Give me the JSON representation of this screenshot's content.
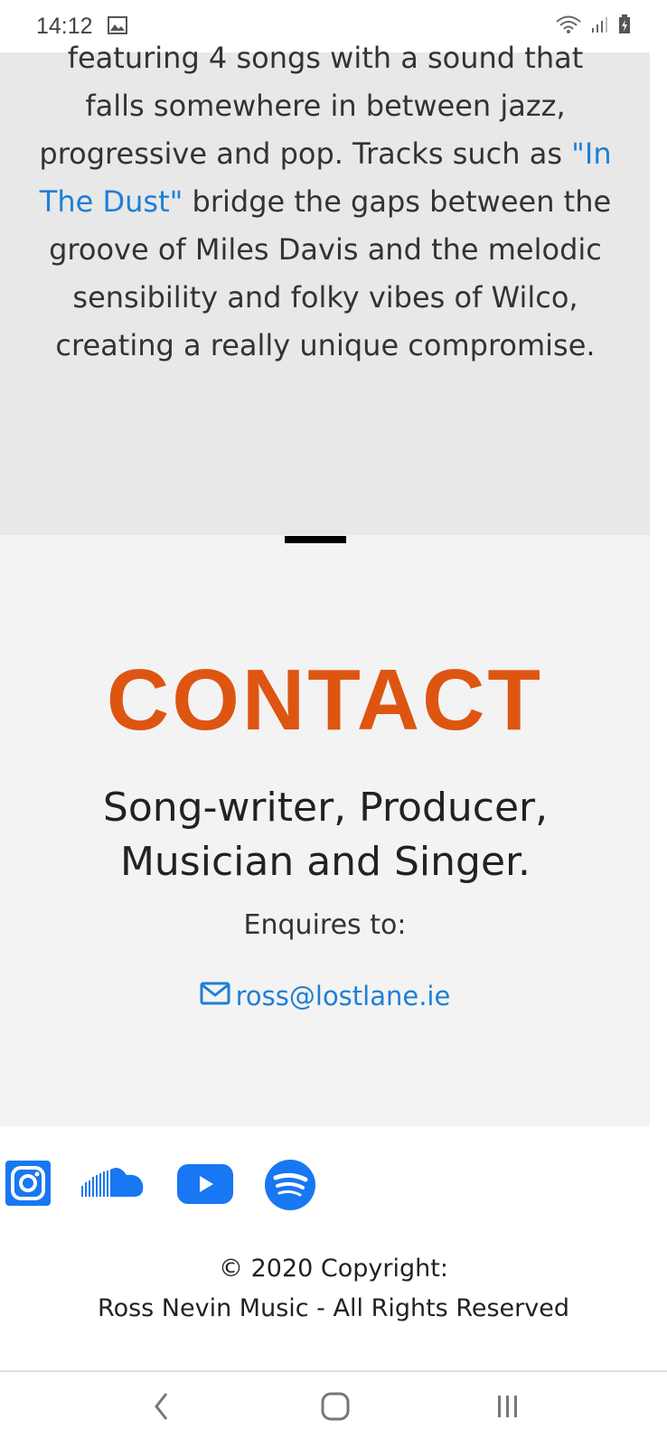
{
  "status_bar": {
    "time": "14:12"
  },
  "about": {
    "text_before_link": "featuring 4 songs with a sound that falls somewhere in between jazz, progressive and pop. Tracks such as ",
    "link_text": "\"In The Dust\"",
    "text_after_link": " bridge the gaps between the groove of Miles Davis and the melodic sensibility and folky vibes of Wilco, creating a really unique compromise."
  },
  "contact": {
    "title": "CONTACT",
    "subtitle": "Song-writer, Producer, Musician and Singer.",
    "enquiries_label": "Enquires to:",
    "email": "ross@lostlane.ie"
  },
  "social": [
    {
      "icon": "instagram-icon",
      "color": "#1877f2"
    },
    {
      "icon": "soundcloud-icon",
      "color": "#1877f2"
    },
    {
      "icon": "youtube-icon",
      "color": "#1877f2"
    },
    {
      "icon": "spotify-icon",
      "color": "#1877f2"
    }
  ],
  "footer": {
    "copyright_line": "© 2020 Copyright:",
    "rights_line": "Ross Nevin Music - All Rights Reserved"
  },
  "colors": {
    "accent_orange": "#de5512",
    "link_blue": "#1e7fd6",
    "icon_blue": "#1877f2"
  }
}
